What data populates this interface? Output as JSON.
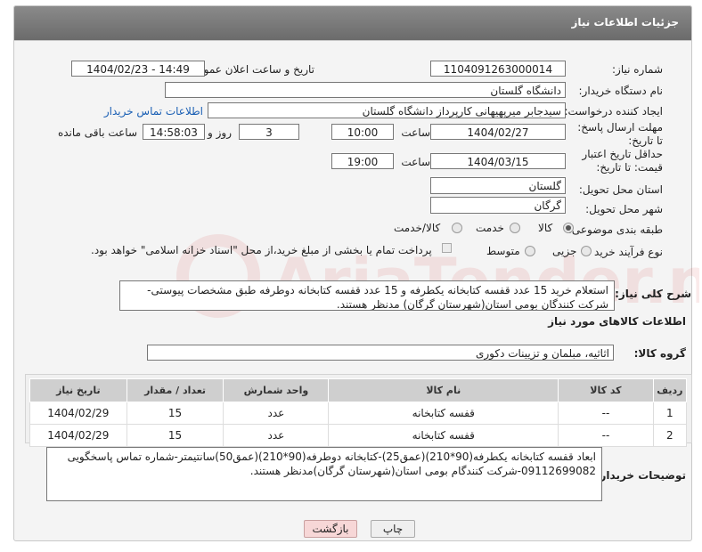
{
  "header": {
    "title": "جزئیات اطلاعات نیاز"
  },
  "fields": {
    "need_number_label": "شماره نیاز:",
    "need_number": "1104091263000014",
    "announce_label": "تاریخ و ساعت اعلان عمومی:",
    "announce_value": "1404/02/23 - 14:49",
    "buyer_org_label": "نام دستگاه خریدار:",
    "buyer_org": "دانشگاه گلستان",
    "requester_label": "ایجاد کننده درخواست:",
    "requester": "سیدجابر میرپهیهانی کارپرداز دانشگاه گلستان",
    "contact_link": "اطلاعات تماس خریدار",
    "deadline_label": "مهلت ارسال پاسخ: تا تاریخ:",
    "deadline_date": "1404/02/27",
    "time_label": "ساعت",
    "deadline_time": "10:00",
    "days_value": "3",
    "days_label": "روز و",
    "remaining_time": "14:58:03",
    "remaining_label": "ساعت باقی مانده",
    "validity_label": "حداقل تاریخ اعتبار قیمت: تا تاریخ:",
    "validity_date": "1404/03/15",
    "validity_time": "19:00",
    "province_label": "استان محل تحویل:",
    "province": "گلستان",
    "city_label": "شهر محل تحویل:",
    "city": "گرگان",
    "category_label": "طبقه بندی موضوعی:",
    "category_options": [
      "کالا",
      "خدمت",
      "کالا/خدمت"
    ],
    "process_label": "نوع فرآیند خرید :",
    "process_options": [
      "جزیی",
      "متوسط"
    ],
    "payment_note": "پرداخت تمام یا بخشی از مبلغ خرید،از محل \"اسناد خزانه اسلامی\" خواهد بود."
  },
  "description": {
    "label": "شرح کلی نیاز:",
    "text": "استعلام خرید 15 عدد قفسه کتابخانه یکطرفه و 15 عدد قفسه کتابخانه دوطرفه طبق مشخصات پیوستی- شرکت کنندگان بومی استان(شهرستان گرگان) مدنظر هستند."
  },
  "goods": {
    "section_title": "اطلاعات کالاهای مورد نیاز",
    "group_label": "گروه کالا:",
    "group_value": "اثاثیه، مبلمان و تزیینات دکوری",
    "columns": [
      "ردیف",
      "کد کالا",
      "نام کالا",
      "واحد شمارش",
      "تعداد / مقدار",
      "تاریخ نیاز"
    ],
    "rows": [
      [
        "1",
        "--",
        "قفسه کتابخانه",
        "عدد",
        "15",
        "1404/02/29"
      ],
      [
        "2",
        "--",
        "قفسه کتابخانه",
        "عدد",
        "15",
        "1404/02/29"
      ]
    ]
  },
  "buyer_notes": {
    "label": "توضیحات خریدار:",
    "text": "ابعاد قفسه کتابخانه یکطرفه(90*210)(عمق25)-کتابخانه دوطرفه(90*210)(عمق50)سانتیمتر-شماره تماس پاسخگویی 09112699082-شرکت کنندگام بومی استان(شهرستان گرگان)مدنظر هستند."
  },
  "buttons": {
    "print": "چاپ",
    "back": "بازگشت"
  },
  "watermark": "AriaTender.neT",
  "colors": {
    "header": "#777777",
    "link": "#1a5fb4",
    "back_button": "#f7d7d7"
  }
}
